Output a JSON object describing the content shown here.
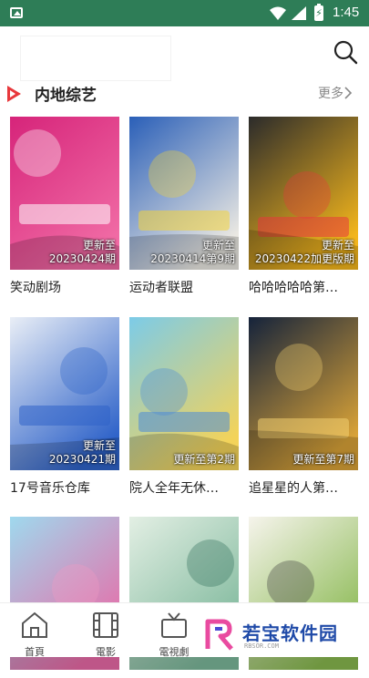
{
  "status_bar": {
    "time": "1:45",
    "battery_glyph": "⚡",
    "icons": [
      "image-icon",
      "wifi-icon",
      "signal-icon",
      "battery-icon"
    ]
  },
  "search": {
    "icon": "search-icon"
  },
  "section": {
    "title": "内地综艺",
    "more_label": "更多"
  },
  "cards": [
    {
      "name": "笑动剧场",
      "ep_line1": "更新至",
      "ep_line2": "20230424期",
      "palette": [
        "#d6247a",
        "#f06aa4"
      ],
      "accent": "#ffffff"
    },
    {
      "name": "运动者联盟",
      "ep_line1": "更新至",
      "ep_line2": "20230414第9期",
      "palette": [
        "#2a5fb8",
        "#eae8e2"
      ],
      "accent": "#f4d33a"
    },
    {
      "name": "哈哈哈哈哈第…",
      "ep_line1": "更新至",
      "ep_line2": "20230422加更版期",
      "palette": [
        "#2b2b2b",
        "#f2b51c"
      ],
      "accent": "#e8383c"
    },
    {
      "name": "17号音乐仓库",
      "ep_line1": "更新至",
      "ep_line2": "20230421期",
      "palette": [
        "#e9eef6",
        "#2f63c9"
      ],
      "accent": "#2f63c9"
    },
    {
      "name": "院人全年无休…",
      "ep_line1": "",
      "ep_line2": "更新至第2期",
      "palette": [
        "#7ccbe8",
        "#f3d35a"
      ],
      "accent": "#4a8ad8"
    },
    {
      "name": "追星星的人第…",
      "ep_line1": "",
      "ep_line2": "更新至第7期",
      "palette": [
        "#15233b",
        "#d8a238"
      ],
      "accent": "#f3d071"
    },
    {
      "name": "",
      "ep_line1": "",
      "ep_line2": "",
      "palette": [
        "#9fd9ee",
        "#e86aa6"
      ],
      "accent": "#f29ac2"
    },
    {
      "name": "",
      "ep_line1": "",
      "ep_line2": "",
      "palette": [
        "#e3efe4",
        "#7cb79a"
      ],
      "accent": "#2f6e5a"
    },
    {
      "name": "",
      "ep_line1": "",
      "ep_line2": "",
      "palette": [
        "#f6f4ec",
        "#88b84f"
      ],
      "accent": "#3c3c3c"
    }
  ],
  "nav": [
    {
      "label": "首頁",
      "icon": "home-icon"
    },
    {
      "label": "電影",
      "icon": "film-icon"
    },
    {
      "label": "電視劇",
      "icon": "tv-icon"
    }
  ],
  "watermark": {
    "text": "若宝软件园",
    "url": "RBSOR.COM"
  }
}
